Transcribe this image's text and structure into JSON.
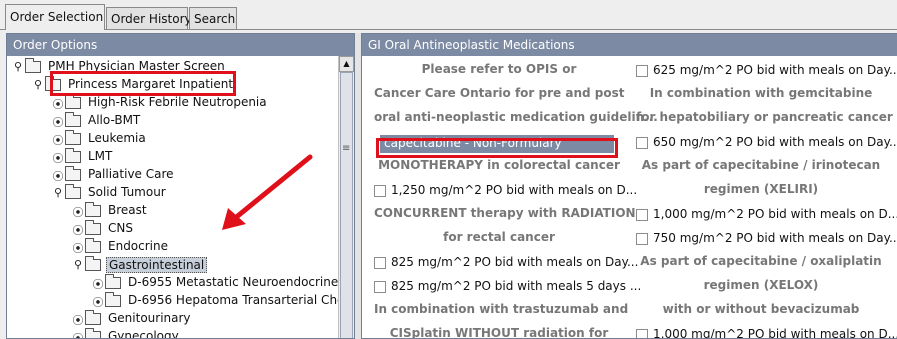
{
  "tabs": [
    {
      "label": "Order Selection",
      "active": true
    },
    {
      "label": "Order History",
      "active": false
    },
    {
      "label": "Search",
      "active": false
    }
  ],
  "left_panel": {
    "title": "Order Options",
    "tree": [
      {
        "label": "PMH Physician Master Screen",
        "handle": "expanded"
      },
      {
        "label": "Princess Margaret Inpatient",
        "handle": "expanded"
      },
      {
        "label": "High-Risk Febrile Neutropenia",
        "handle": "collapsed"
      },
      {
        "label": "Allo-BMT",
        "handle": "collapsed"
      },
      {
        "label": "Leukemia",
        "handle": "collapsed"
      },
      {
        "label": "LMT",
        "handle": "collapsed"
      },
      {
        "label": "Palliative Care",
        "handle": "collapsed"
      },
      {
        "label": "Solid Tumour",
        "handle": "expanded"
      },
      {
        "label": "Breast",
        "handle": "collapsed"
      },
      {
        "label": "CNS",
        "handle": "collapsed"
      },
      {
        "label": "Endocrine",
        "handle": "collapsed"
      },
      {
        "label": "Gastrointestinal",
        "handle": "expanded",
        "selected": true
      },
      {
        "label": "D-6955 Metastatic Neuroendocrine Tu",
        "handle": "collapsed"
      },
      {
        "label": "D-6956 Hepatoma Transarterial Chen",
        "handle": "collapsed"
      },
      {
        "label": "Genitourinary",
        "handle": "collapsed"
      },
      {
        "label": "Gynecology",
        "handle": "collapsed"
      }
    ]
  },
  "right_panel": {
    "title": "GI Oral Antineoplastic Medications",
    "left_column": [
      {
        "kind": "heading",
        "text": "Please refer to OPIS or"
      },
      {
        "kind": "heading",
        "text": "Cancer Care Ontario for pre and post"
      },
      {
        "kind": "heading",
        "text": "oral anti-neoplastic medication guidelin..."
      },
      {
        "kind": "selected",
        "text": "capecitabine - Non-Formulary"
      },
      {
        "kind": "heading",
        "text": "MONOTHERAPY in colorectal cancer"
      },
      {
        "kind": "order",
        "text": "1,250 mg/m^2 PO bid with meals on D..."
      },
      {
        "kind": "heading",
        "text": "CONCURRENT therapy with RADIATION"
      },
      {
        "kind": "heading",
        "text": "for rectal cancer"
      },
      {
        "kind": "order",
        "text": "825 mg/m^2 PO bid with meals on Day..."
      },
      {
        "kind": "order",
        "text": "825 mg/m^2 PO bid with meals 5 days ..."
      },
      {
        "kind": "heading",
        "text": "In combination with trastuzumab and"
      },
      {
        "kind": "heading",
        "text": "CISplatin WITHOUT radiation for"
      }
    ],
    "right_column": [
      {
        "kind": "order",
        "text": "625 mg/m^2 PO bid with meals on Day..."
      },
      {
        "kind": "heading",
        "text": "In combination with gemcitabine"
      },
      {
        "kind": "heading",
        "text": "for hepatobiliary or pancreatic cancer"
      },
      {
        "kind": "order",
        "text": "650 mg/m^2 PO bid with meals on Day..."
      },
      {
        "kind": "heading",
        "text": "As part of capecitabine / irinotecan"
      },
      {
        "kind": "heading",
        "text": "regimen (XELIRI)"
      },
      {
        "kind": "order",
        "text": "1,000 mg/m^2 PO bid with meals on D..."
      },
      {
        "kind": "order",
        "text": "750 mg/m^2 PO bid with meals on Day..."
      },
      {
        "kind": "heading",
        "text": "As part of capecitabine / oxaliplatin"
      },
      {
        "kind": "heading",
        "text": "regimen (XELOX)"
      },
      {
        "kind": "heading",
        "text": "with or without bevacizumab"
      },
      {
        "kind": "order",
        "text": "1,000 mg/m^2 PO bid with meals on D..."
      }
    ]
  },
  "icons": {
    "expanded_handle": "expanded-handle-icon",
    "collapsed_handle": "collapsed-handle-icon",
    "folder": "folder-icon"
  },
  "colors": {
    "panel_header": "#7c8ba3",
    "annotation": "#e0101a",
    "selection": "#7c8ba3",
    "heading_text": "#777777"
  }
}
